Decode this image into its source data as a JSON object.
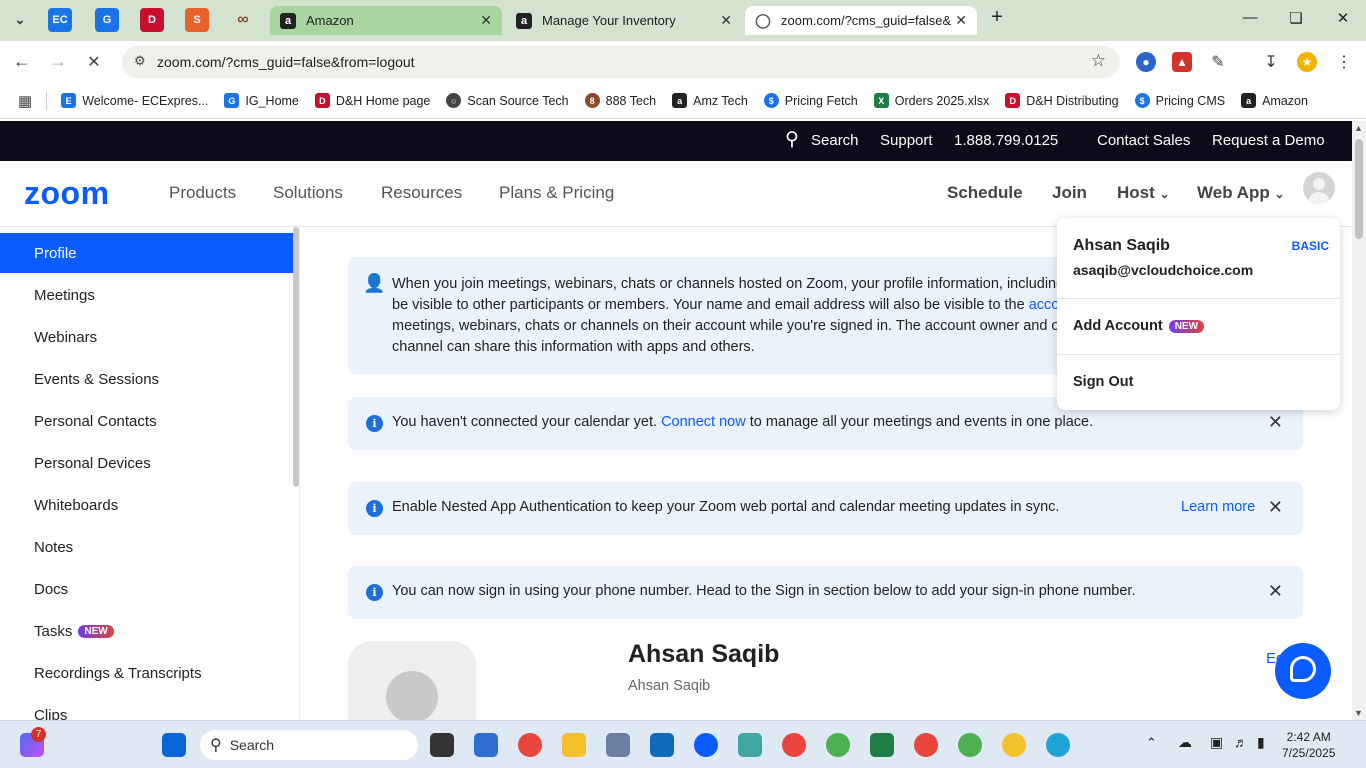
{
  "browser": {
    "tabs": [
      {
        "title": "Amazon",
        "active": false
      },
      {
        "title": "Manage Your Inventory",
        "active": false
      },
      {
        "title": "zoom.com/?cms_guid=false&fr",
        "active": true
      }
    ],
    "url": "zoom.com/?cms_guid=false&from=logout",
    "bookmarks": [
      {
        "label": "Welcome- ECExpres...",
        "color": "#1a73e8"
      },
      {
        "label": "IG_Home",
        "color": "#1a73e8"
      },
      {
        "label": "D&H Home page",
        "color": "#c8102e"
      },
      {
        "label": "Scan Source Tech",
        "color": "#444444"
      },
      {
        "label": "888 Tech",
        "color": "#8a4b2b"
      },
      {
        "label": "Amz Tech",
        "color": "#222222"
      },
      {
        "label": "Pricing Fetch",
        "color": "#1a73e8"
      },
      {
        "label": "Orders 2025.xlsx",
        "color": "#1e7e45"
      },
      {
        "label": "D&H Distributing",
        "color": "#c8102e"
      },
      {
        "label": "Pricing CMS",
        "color": "#1a73e8"
      },
      {
        "label": "Amazon",
        "color": "#222222"
      }
    ]
  },
  "topbar": {
    "search": "Search",
    "support": "Support",
    "phone": "1.888.799.0125",
    "contact_sales": "Contact Sales",
    "request_demo": "Request a Demo"
  },
  "nav": {
    "logo": "zoom",
    "products": "Products",
    "solutions": "Solutions",
    "resources": "Resources",
    "plans": "Plans & Pricing",
    "schedule": "Schedule",
    "join": "Join",
    "host": "Host",
    "web_app": "Web App"
  },
  "sidebar": {
    "items": [
      {
        "label": "Profile",
        "active": true
      },
      {
        "label": "Meetings"
      },
      {
        "label": "Webinars"
      },
      {
        "label": "Events & Sessions"
      },
      {
        "label": "Personal Contacts"
      },
      {
        "label": "Personal Devices"
      },
      {
        "label": "Whiteboards"
      },
      {
        "label": "Notes"
      },
      {
        "label": "Docs"
      },
      {
        "label": "Tasks",
        "badge": "NEW"
      },
      {
        "label": "Recordings & Transcripts"
      },
      {
        "label": "Clips"
      }
    ]
  },
  "notices": {
    "privacy": {
      "line1": "When you join meetings, webinars, chats or channels hosted on Zoom, your profile information, including yo",
      "line2_pre": "be visible to other participants or members. Your name and email address will also be visible to the ",
      "line2_link": "accoun",
      "line3": "meetings, webinars, chats or channels on their account while you're signed in. The account owner and othe",
      "line4": "channel can share this information with apps and others."
    },
    "calendar": {
      "pre": "You haven't connected your calendar yet. ",
      "link": "Connect now",
      "post": " to manage all your meetings and events in one place."
    },
    "nested": {
      "text": "Enable Nested App Authentication to keep your Zoom web portal and calendar meeting updates in sync.",
      "link": "Learn more"
    },
    "phone": {
      "text": "You can now sign in using your phone number. Head to the Sign in section below to add your sign-in phone number."
    }
  },
  "profile": {
    "name": "Ahsan Saqib",
    "sub": "Ahsan Saqib",
    "edit": "Ed"
  },
  "dropdown": {
    "name": "Ahsan Saqib",
    "plan": "BASIC",
    "email": "asaqib@vcloudchoice.com",
    "add_account": "Add Account",
    "new_badge": "NEW",
    "sign_out": "Sign Out"
  },
  "taskbar": {
    "search": "Search",
    "time": "2:42 AM",
    "date": "7/25/2025",
    "notification_count": "7"
  }
}
